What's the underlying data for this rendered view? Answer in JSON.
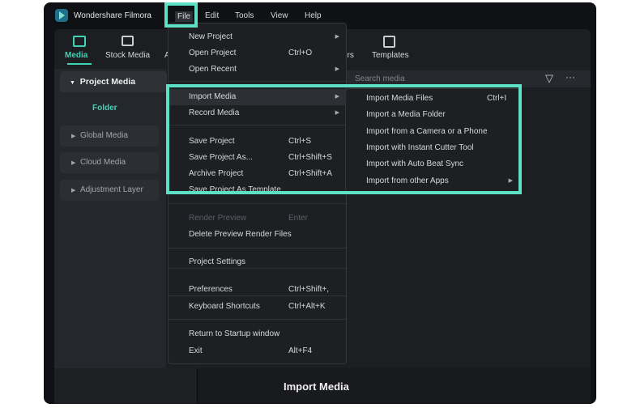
{
  "app": {
    "title": "Wondershare Filmora"
  },
  "menubar": [
    "File",
    "Edit",
    "Tools",
    "View",
    "Help"
  ],
  "tabs": [
    {
      "label": "Media",
      "active": true
    },
    {
      "label": "Stock Media"
    },
    {
      "label": "A"
    },
    {
      "label": "ers"
    },
    {
      "label": "Templates"
    }
  ],
  "search": {
    "placeholder": "Search media"
  },
  "sidebar": {
    "project_media": "Project Media",
    "folder": "Folder",
    "items": [
      "Global Media",
      "Cloud Media",
      "Adjustment Layer"
    ]
  },
  "bottom": {
    "title": "Import Media"
  },
  "file_menu": [
    {
      "label": "New Project",
      "submenu": true
    },
    {
      "label": "Open Project",
      "shortcut": "Ctrl+O"
    },
    {
      "label": "Open Recent",
      "submenu": true
    },
    {
      "label": "Import Media",
      "submenu": true,
      "highlighted": true
    },
    {
      "label": "Record Media",
      "submenu": true
    },
    {
      "label": "Save Project",
      "shortcut": "Ctrl+S"
    },
    {
      "label": "Save Project As...",
      "shortcut": "Ctrl+Shift+S"
    },
    {
      "label": "Archive Project",
      "shortcut": "Ctrl+Shift+A"
    },
    {
      "label": "Save Project As Template"
    },
    {
      "label": "Render Preview",
      "shortcut": "Enter",
      "disabled": true
    },
    {
      "label": "Delete Preview Render Files"
    },
    {
      "label": "Project Settings"
    },
    {
      "label": "Preferences",
      "shortcut": "Ctrl+Shift+,"
    },
    {
      "label": "Keyboard Shortcuts",
      "shortcut": "Ctrl+Alt+K"
    },
    {
      "label": "Return to Startup window"
    },
    {
      "label": "Exit",
      "shortcut": "Alt+F4"
    }
  ],
  "import_submenu": [
    {
      "label": "Import Media Files",
      "shortcut": "Ctrl+I"
    },
    {
      "label": "Import a Media Folder"
    },
    {
      "label": "Import from a Camera or a Phone"
    },
    {
      "label": "Import with Instant Cutter Tool"
    },
    {
      "label": "Import with Auto Beat Sync"
    },
    {
      "label": "Import from other Apps",
      "submenu": true
    }
  ],
  "colors": {
    "highlight": "#5ce0c6",
    "accent": "#3fd3b5"
  }
}
